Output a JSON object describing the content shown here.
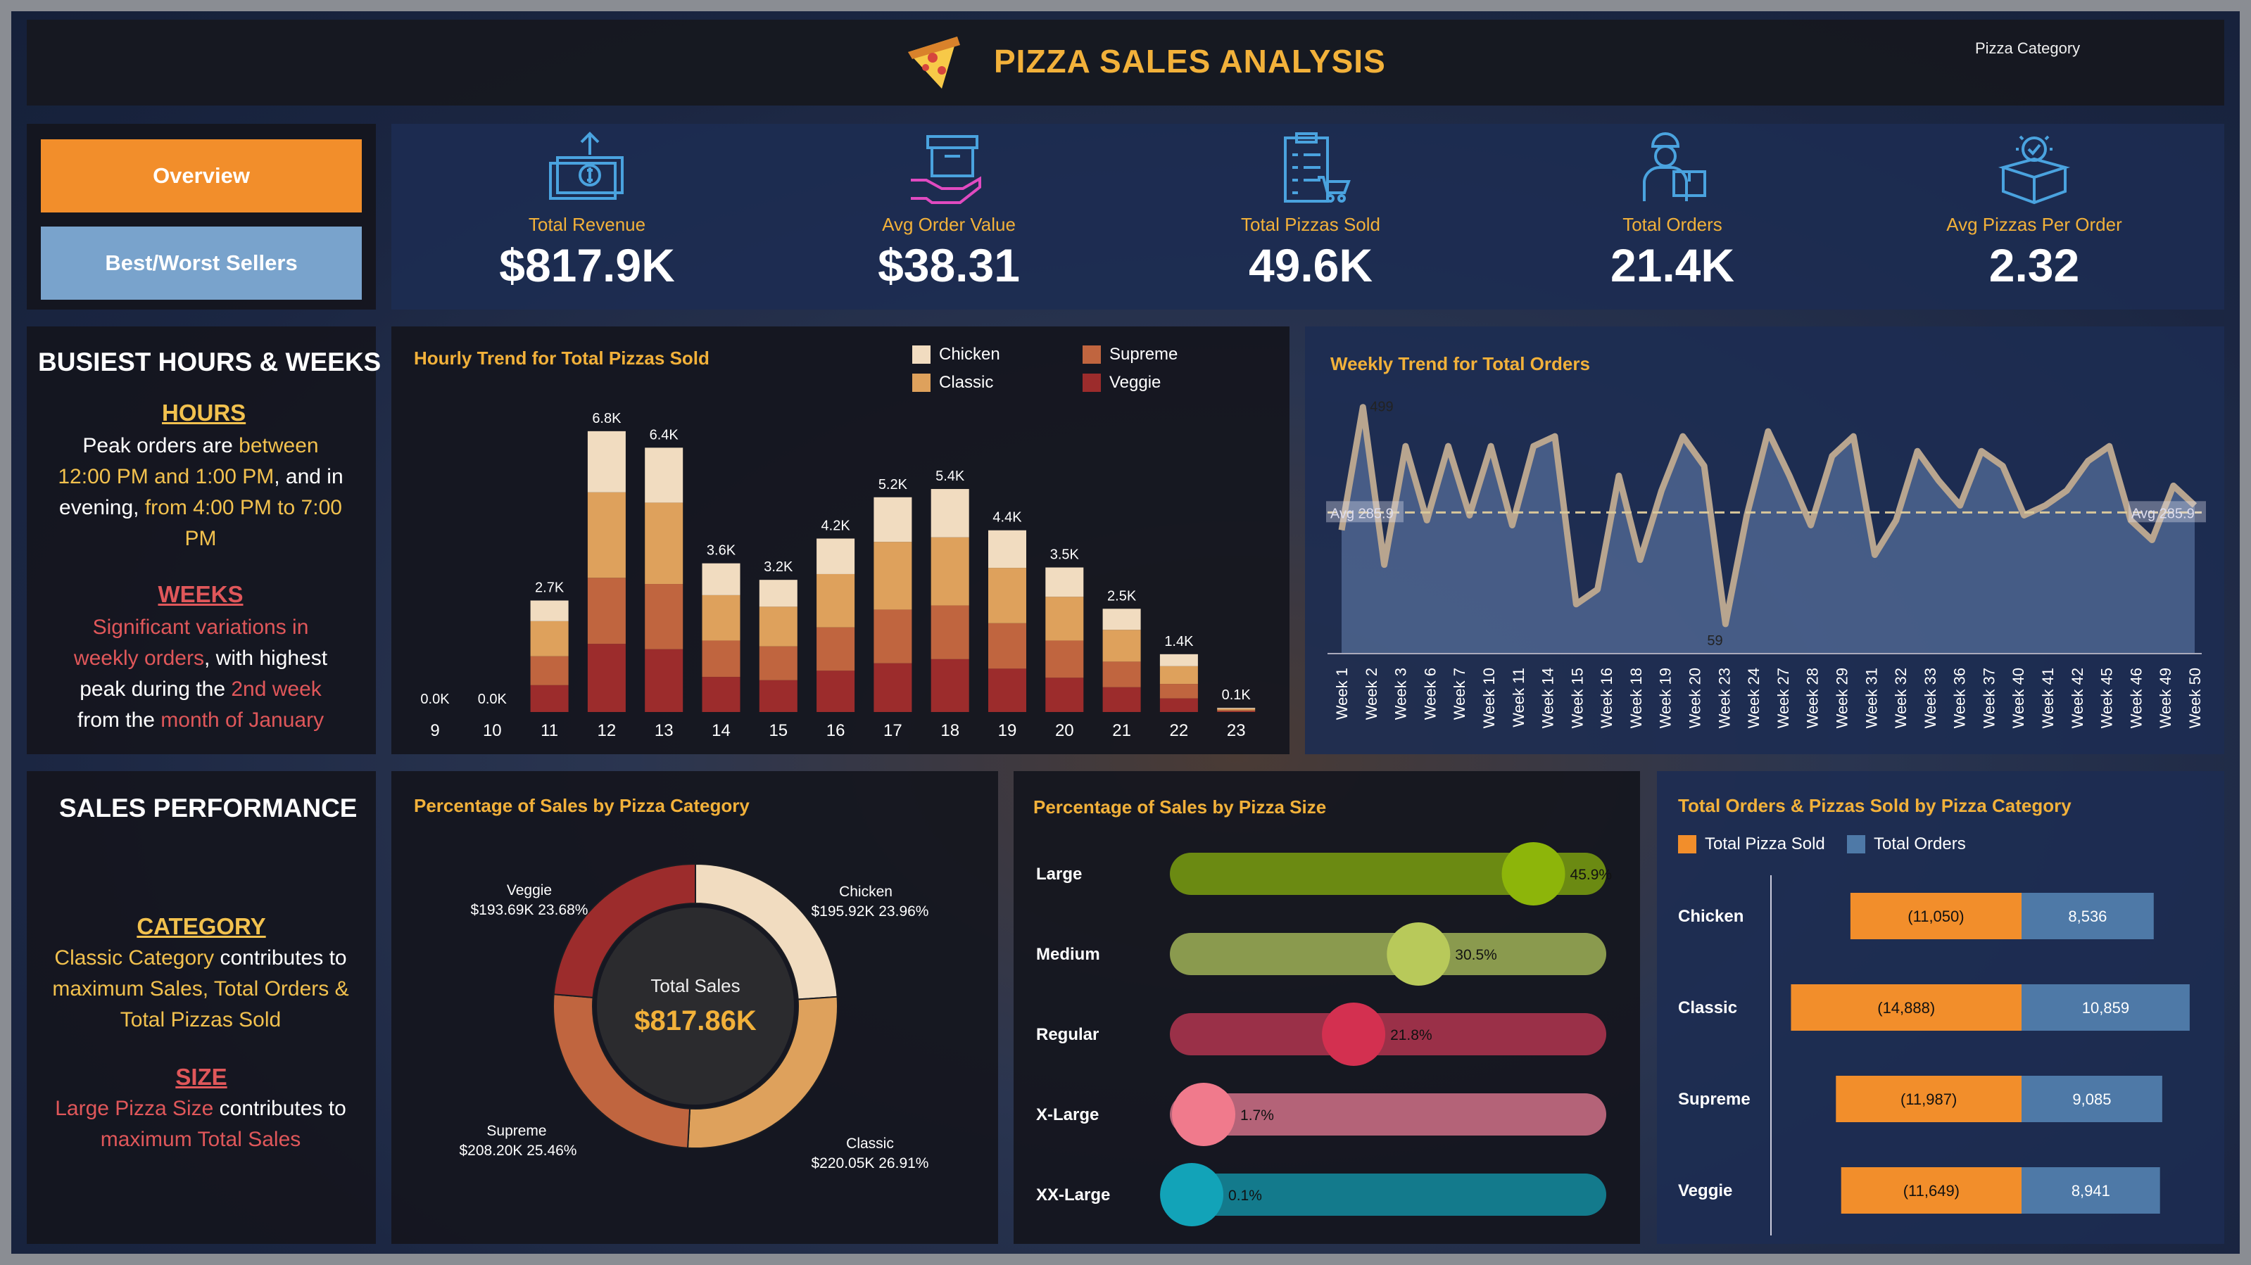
{
  "header": {
    "title": "PIZZA SALES ANALYSIS",
    "filter_label": "Pizza Category"
  },
  "nav": {
    "overview": "Overview",
    "best_worst": "Best/Worst Sellers",
    "overview_color": "#f28e2b",
    "best_worst_color": "#79a3cc"
  },
  "kpis": [
    {
      "label": "Total Revenue",
      "value": "$817.9K",
      "icon": "money-icon"
    },
    {
      "label": "Avg Order Value",
      "value": "$38.31",
      "icon": "box-hand-icon"
    },
    {
      "label": "Total Pizzas Sold",
      "value": "49.6K",
      "icon": "clipboard-cart-icon"
    },
    {
      "label": "Total Orders",
      "value": "21.4K",
      "icon": "delivery-man-icon"
    },
    {
      "label": "Avg Pizzas Per Order",
      "value": "2.32",
      "icon": "box-check-icon"
    }
  ],
  "busiest": {
    "title": "BUSIEST HOURS & WEEKS",
    "hours_title": "HOURS",
    "hours_text": [
      "Peak orders are ",
      "between",
      "12:00 PM and 1:00 PM",
      ", and in",
      "evening, ",
      "from 4:00 PM to 7:00",
      "PM"
    ],
    "weeks_title": "WEEKS",
    "weeks_text": [
      "Significant variations in",
      "weekly orders",
      ", with highest",
      "peak during the ",
      "2nd week",
      "from the ",
      "month of January"
    ]
  },
  "sales_perf": {
    "title": "SALES PERFORMANCE",
    "category_title": "CATEGORY",
    "category_text": [
      "Classic Category",
      " contributes to",
      "maximum Sales, Total Orders &",
      "Total Pizzas Sold"
    ],
    "size_title": "SIZE",
    "size_text": [
      "Large Pizza Size",
      " contributes to",
      "maximum Total Sales"
    ]
  },
  "hourly_chart": {
    "title": "Hourly Trend for Total Pizzas Sold",
    "legend": [
      {
        "name": "Chicken",
        "color": "#f1dcc0"
      },
      {
        "name": "Classic",
        "color": "#dea15c"
      },
      {
        "name": "Supreme",
        "color": "#c0653f"
      },
      {
        "name": "Veggie",
        "color": "#9c2c2c"
      }
    ]
  },
  "weekly_chart": {
    "title": "Weekly Trend for Total Orders",
    "avg_label": "Avg 285.9",
    "max_label": "499",
    "min_label": "59"
  },
  "category_donut": {
    "title": "Percentage of Sales by Pizza Category",
    "center_label": "Total Sales",
    "center_value": "$817.86K",
    "slices": [
      {
        "name": "Chicken",
        "value_label": "$195.92K",
        "pct_label": "23.96%",
        "pct": 23.96,
        "color": "#f1dcc0"
      },
      {
        "name": "Classic",
        "value_label": "$220.05K",
        "pct_label": "26.91%",
        "pct": 26.91,
        "color": "#dea15c"
      },
      {
        "name": "Supreme",
        "value_label": "$208.20K",
        "pct_label": "25.46%",
        "pct": 25.46,
        "color": "#c0653f"
      },
      {
        "name": "Veggie",
        "value_label": "$193.69K",
        "pct_label": "23.68%",
        "pct": 23.68,
        "color": "#9c2c2c"
      }
    ]
  },
  "size_chart": {
    "title": "Percentage of Sales by Pizza Size",
    "rows": [
      {
        "name": "Large",
        "pct": 45.9,
        "label": "45.9%",
        "bar": "#6b8a12",
        "dot": "#8db50a"
      },
      {
        "name": "Medium",
        "pct": 30.5,
        "label": "30.5%",
        "bar": "#8a9a4e",
        "dot": "#b8c95a"
      },
      {
        "name": "Regular",
        "pct": 21.8,
        "label": "21.8%",
        "bar": "#9a3048",
        "dot": "#d33050"
      },
      {
        "name": "X-Large",
        "pct": 1.7,
        "label": "1.7%",
        "bar": "#b46378",
        "dot": "#f07a8c"
      },
      {
        "name": "XX-Large",
        "pct": 0.1,
        "label": "0.1%",
        "bar": "#137a8c",
        "dot": "#12a3b8"
      }
    ]
  },
  "orders_chart": {
    "title": "Total Orders & Pizzas Sold by Pizza Category",
    "legend_sold": "Total Pizza Sold",
    "legend_orders": "Total Orders",
    "sold_color": "#f28e2b",
    "orders_color": "#4e79a7"
  },
  "chart_data": [
    {
      "type": "bar",
      "title": "Hourly Trend for Total Pizzas Sold",
      "categories": [
        "9",
        "10",
        "11",
        "12",
        "13",
        "14",
        "15",
        "16",
        "17",
        "18",
        "19",
        "20",
        "21",
        "22",
        "23"
      ],
      "totals_labels": [
        "0.0K",
        "0.0K",
        "2.7K",
        "6.8K",
        "6.4K",
        "3.6K",
        "3.2K",
        "4.2K",
        "5.2K",
        "5.4K",
        "4.4K",
        "3.5K",
        "2.5K",
        "1.4K",
        "0.1K"
      ],
      "series": [
        {
          "name": "Veggie",
          "values": [
            0,
            0,
            650,
            1650,
            1520,
            850,
            770,
            1000,
            1180,
            1280,
            1050,
            830,
            600,
            330,
            20
          ]
        },
        {
          "name": "Supreme",
          "values": [
            0,
            0,
            700,
            1600,
            1580,
            880,
            820,
            1050,
            1300,
            1300,
            1100,
            900,
            620,
            350,
            25
          ]
        },
        {
          "name": "Classic",
          "values": [
            0,
            0,
            850,
            2070,
            1970,
            1100,
            960,
            1290,
            1640,
            1650,
            1340,
            1060,
            770,
            430,
            35
          ]
        },
        {
          "name": "Chicken",
          "values": [
            0,
            0,
            500,
            1480,
            1330,
            770,
            650,
            860,
            1080,
            1170,
            910,
            710,
            510,
            290,
            20
          ]
        }
      ],
      "ylim": [
        0,
        7000
      ]
    },
    {
      "type": "area",
      "title": "Weekly Trend for Total Orders",
      "x": [
        "Week 1",
        "Week 2",
        "Week 3",
        "Week 6",
        "Week 7",
        "Week 10",
        "Week 11",
        "Week 14",
        "Week 15",
        "Week 16",
        "Week 18",
        "Week 19",
        "Week 20",
        "Week 23",
        "Week 24",
        "Week 27",
        "Week 28",
        "Week 29",
        "Week 31",
        "Week 32",
        "Week 33",
        "Week 36",
        "Week 37",
        "Week 40",
        "Week 41",
        "Week 42",
        "Week 45",
        "Week 46",
        "Week 49",
        "Week 50"
      ],
      "values": [
        250,
        499,
        180,
        420,
        270,
        420,
        280,
        420,
        260,
        420,
        440,
        100,
        130,
        360,
        190,
        330,
        440,
        380,
        60,
        280,
        450,
        360,
        260,
        400,
        440,
        200,
        270,
        410,
        350,
        300,
        410,
        380,
        280,
        300,
        330,
        390,
        420,
        270,
        230,
        340,
        300
      ],
      "avg": 285.9,
      "ylim": [
        0,
        520
      ]
    },
    {
      "type": "pie",
      "title": "Percentage of Sales by Pizza Category",
      "categories": [
        "Chicken",
        "Classic",
        "Supreme",
        "Veggie"
      ],
      "values": [
        195.92,
        220.05,
        208.2,
        193.69
      ],
      "percent": [
        23.96,
        26.91,
        25.46,
        23.68
      ]
    },
    {
      "type": "bar",
      "title": "Percentage of Sales by Pizza Size",
      "categories": [
        "Large",
        "Medium",
        "Regular",
        "X-Large",
        "XX-Large"
      ],
      "values": [
        45.9,
        30.5,
        21.8,
        1.7,
        0.1
      ]
    },
    {
      "type": "bar",
      "title": "Total Orders & Pizzas Sold by Pizza Category",
      "categories": [
        "Chicken",
        "Classic",
        "Supreme",
        "Veggie"
      ],
      "series": [
        {
          "name": "Total Pizza Sold",
          "values": [
            11050,
            14888,
            11987,
            11649
          ],
          "labels": [
            "(11,050)",
            "(14,888)",
            "(11,987)",
            "(11,649)"
          ]
        },
        {
          "name": "Total Orders",
          "values": [
            8536,
            10859,
            9085,
            8941
          ],
          "labels": [
            "8,536",
            "10,859",
            "9,085",
            "8,941"
          ]
        }
      ]
    }
  ]
}
